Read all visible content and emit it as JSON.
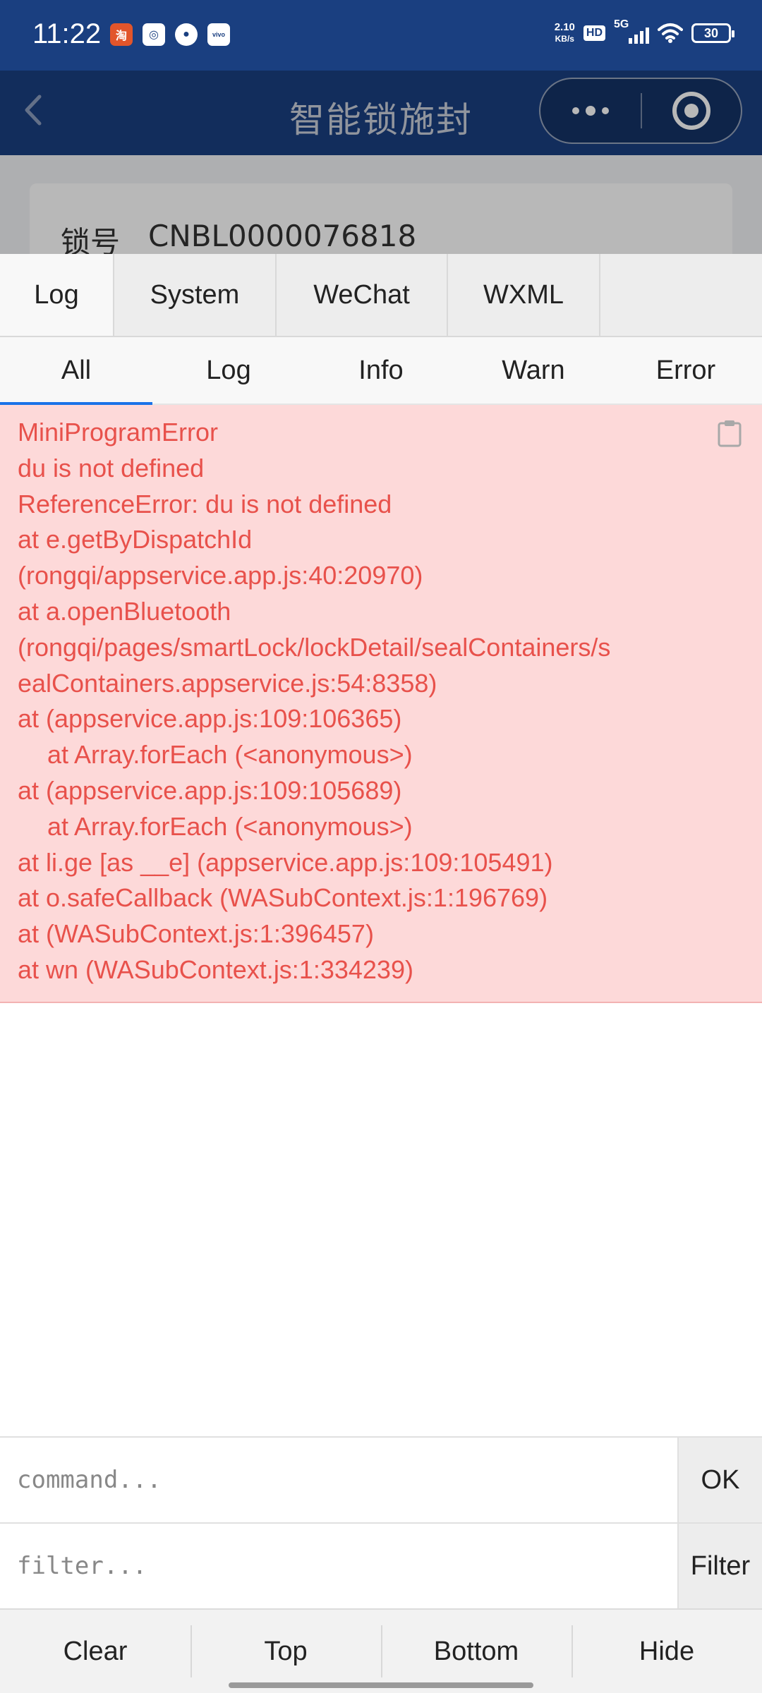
{
  "status_bar": {
    "time": "11:22",
    "apps": [
      {
        "icon": "taobao-red-app-icon",
        "glyph": "淘"
      },
      {
        "icon": "camera-app-icon",
        "glyph": "◎"
      },
      {
        "icon": "message-app-icon",
        "glyph": "●"
      },
      {
        "icon": "vivo-app-icon",
        "glyph": "vivo"
      }
    ],
    "net_speed_value": "2.10",
    "net_speed_unit": "KB/s",
    "hd_label": "HD",
    "network_label": "5G",
    "battery_level": "30"
  },
  "nav": {
    "title": "智能锁施封",
    "back_icon": "chevron-left-icon",
    "more_icon": "more-dots-icon",
    "close_icon": "target-circle-icon"
  },
  "page": {
    "lock_label": "锁号",
    "lock_number": "CNBL0000076818"
  },
  "vconsole": {
    "tabs": [
      {
        "label": "Log",
        "active": true
      },
      {
        "label": "System",
        "active": false
      },
      {
        "label": "WeChat",
        "active": false
      },
      {
        "label": "WXML",
        "active": false
      }
    ],
    "subtabs": [
      {
        "label": "All",
        "active": true
      },
      {
        "label": "Log",
        "active": false
      },
      {
        "label": "Info",
        "active": false
      },
      {
        "label": "Warn",
        "active": false
      },
      {
        "label": "Error",
        "active": false
      }
    ],
    "error_lines": [
      "MiniProgramError",
      "du is not defined",
      "ReferenceError: du is not defined",
      "at e.getByDispatchId",
      "(rongqi/appservice.app.js:40:20970)",
      "at a.openBluetooth",
      "(rongqi/pages/smartLock/lockDetail/sealContainers/s",
      "ealContainers.appservice.js:54:8358)",
      "at (appservice.app.js:109:106365)",
      "at Array.forEach (<anonymous>)",
      "at (appservice.app.js:109:105689)",
      "at Array.forEach (<anonymous>)",
      "at li.ge [as __e] (appservice.app.js:109:105491)",
      "at o.safeCallback (WASubContext.js:1:196769)",
      "at (WASubContext.js:1:396457)",
      "at wn (WASubContext.js:1:334239)"
    ],
    "error_line_indented": [
      false,
      false,
      false,
      false,
      false,
      false,
      false,
      false,
      false,
      true,
      false,
      true,
      false,
      false,
      false,
      false
    ],
    "copy_icon": "clipboard-icon",
    "command": {
      "placeholder": "command...",
      "button": "OK"
    },
    "filter": {
      "placeholder": "filter...",
      "button": "Filter"
    },
    "toolbar": [
      "Clear",
      "Top",
      "Bottom",
      "Hide"
    ],
    "colors": {
      "error_bg": "#fdd9d9",
      "error_text": "#e8514b",
      "active_tab_underline": "#1a73e8",
      "nav_bg": "#1a3f80"
    }
  }
}
